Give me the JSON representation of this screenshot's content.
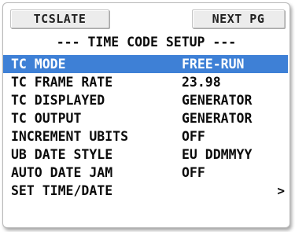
{
  "softkeys": {
    "left_label": "TCSLATE",
    "right_label": "NEXT PG"
  },
  "page_title": "--- TIME CODE SETUP ---",
  "menu": {
    "items": [
      {
        "label": "TC MODE",
        "value": "FREE-RUN",
        "selected": true
      },
      {
        "label": "TC FRAME RATE",
        "value": "23.98",
        "selected": false
      },
      {
        "label": "TC DISPLAYED",
        "value": "GENERATOR",
        "selected": false
      },
      {
        "label": "TC OUTPUT",
        "value": "GENERATOR",
        "selected": false
      },
      {
        "label": "INCREMENT UBITS",
        "value": "OFF",
        "selected": false
      },
      {
        "label": "UB DATE STYLE",
        "value": "EU DDMMYY",
        "selected": false
      },
      {
        "label": "AUTO DATE JAM",
        "value": "OFF",
        "selected": false
      },
      {
        "label": "SET TIME/DATE",
        "value": "",
        "arrow": ">",
        "selected": false
      }
    ]
  },
  "colors": {
    "selection": "#3e80d6",
    "text": "#0b0b0b",
    "softkey_bg": "#ececec"
  }
}
